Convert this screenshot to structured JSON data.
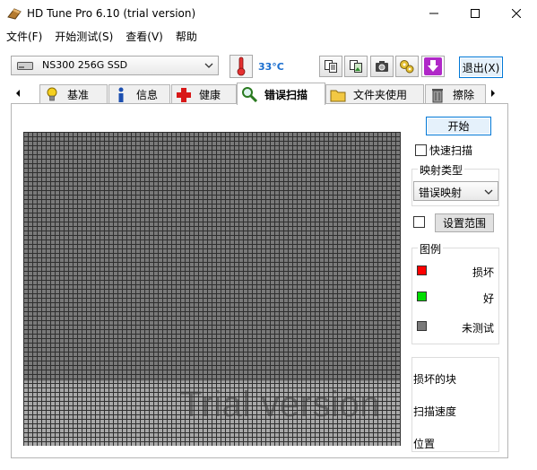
{
  "window": {
    "title": "HD Tune Pro 6.10 (trial version)"
  },
  "menu": {
    "items": [
      "文件(F)",
      "开始测试(S)",
      "查看(V)",
      "帮助"
    ]
  },
  "toolbar": {
    "drive": "NS300 256G SSD",
    "temperature": "33°C",
    "exit_label": "退出(X)"
  },
  "tabs": [
    {
      "label": "基准",
      "icon": "lightbulb-icon"
    },
    {
      "label": "信息",
      "icon": "info-icon"
    },
    {
      "label": "健康",
      "icon": "health-cross-icon"
    },
    {
      "label": "错误扫描",
      "icon": "magnifier-icon",
      "active": true
    },
    {
      "label": "文件夹使用",
      "icon": "folder-icon"
    },
    {
      "label": "擦除",
      "icon": "trash-icon"
    }
  ],
  "scan": {
    "start_label": "开始",
    "quick_scan_label": "快速扫描",
    "map_type_title": "映射类型",
    "map_type_value": "错误映射",
    "set_range_label": "设置范围",
    "legend_title": "图例",
    "legend": [
      {
        "label": "损坏",
        "color": "#ff0000"
      },
      {
        "label": "好",
        "color": "#00dd00"
      },
      {
        "label": "未测试",
        "color": "#7a7a7a"
      }
    ],
    "damaged_blocks_label": "损坏的块",
    "scan_speed_label": "扫描速度",
    "position_label": "位置",
    "watermark": "Trial version"
  },
  "colors": {
    "accent": "#0078d7",
    "grid_untested": "#7a7a7a",
    "grid_lower": "#a8a8a8",
    "temperature": "#1a6ecf"
  }
}
